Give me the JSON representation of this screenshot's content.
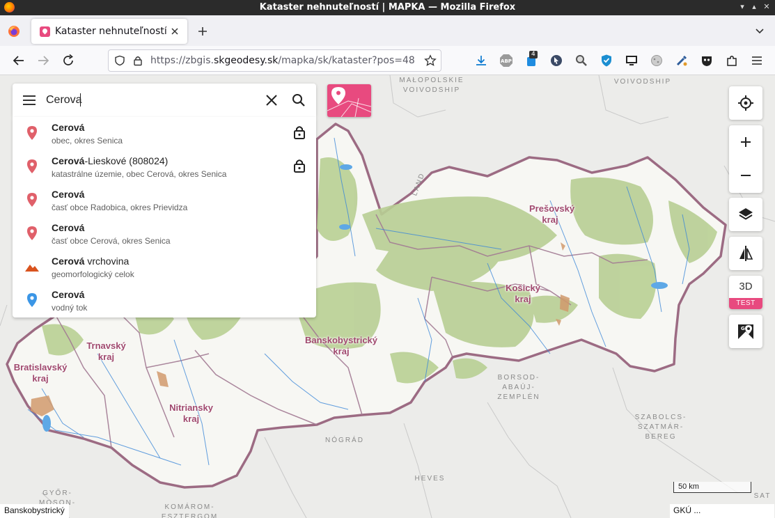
{
  "window": {
    "title": "Kataster nehnuteľností | MAPKA — Mozilla Firefox"
  },
  "browser": {
    "tab_title": "Kataster nehnuteľností | MAPKA",
    "url_prefix": "https://zbgis.",
    "url_domain": "skgeodesy.sk",
    "url_path": "/mapka/sk/kataster?pos=48.",
    "extension_badge": "4"
  },
  "search": {
    "value": "Cerova",
    "results": [
      {
        "title_bold": "Cerová",
        "title_rest": "",
        "subtitle": "obec, okres Senica",
        "icon": "map-pin-red-icon",
        "locked": true
      },
      {
        "title_bold": "Cerová",
        "title_rest": "-Lieskové (808024)",
        "subtitle": "katastrálne územie, obec Cerová, okres Senica",
        "icon": "map-pin-red-icon",
        "locked": true
      },
      {
        "title_bold": "Cerová",
        "title_rest": "",
        "subtitle": "časť obce Radobica, okres Prievidza",
        "icon": "map-pin-red-icon",
        "locked": false
      },
      {
        "title_bold": "Cerová",
        "title_rest": "",
        "subtitle": "časť obce Cerová, okres Senica",
        "icon": "map-pin-red-icon",
        "locked": false
      },
      {
        "title_bold": "Cerová",
        "title_rest": " vrchovina",
        "subtitle": "geomorfologický celok",
        "icon": "mountain-icon",
        "locked": false
      },
      {
        "title_bold": "Cerová",
        "title_rest": "",
        "subtitle": "vodný tok",
        "icon": "map-pin-blue-icon",
        "locked": false
      }
    ]
  },
  "map": {
    "regions": {
      "presov": "Prešovský kraj",
      "kosice": "Košický kraj",
      "banska": "Banskobystrický kraj",
      "trnava": "Trnavský kraj",
      "bratislava": "Bratislavský kraj",
      "nitra": "Nitriansky kraj"
    },
    "foreign": {
      "malopolskie": "MAŁOPOLSKIE VOIVODSHIP",
      "voivodship": "VOIVODSHIP",
      "borsod": "BORSOD-ABAÚJ-ZEMPLÉN",
      "szabolcs": "SZABOLCS-SZATMÁR-BEREG",
      "nograd": "NÓGRÁD",
      "heves": "HEVES",
      "gyor": "GYŐR-MOSON-",
      "komarom": "KOMÁROM-ESZTERGOM",
      "zland": "LAND",
      "sat": "SAT"
    },
    "controls": {
      "btn3d": "3D",
      "test_badge": "TEST"
    },
    "scale_label": "50 km",
    "status_left": "Banskobystrický",
    "status_right": "GKÚ ..."
  },
  "colors": {
    "brand_pink": "#e84a7f",
    "border_purple": "#a0496e",
    "forest": "#b8cf94"
  }
}
